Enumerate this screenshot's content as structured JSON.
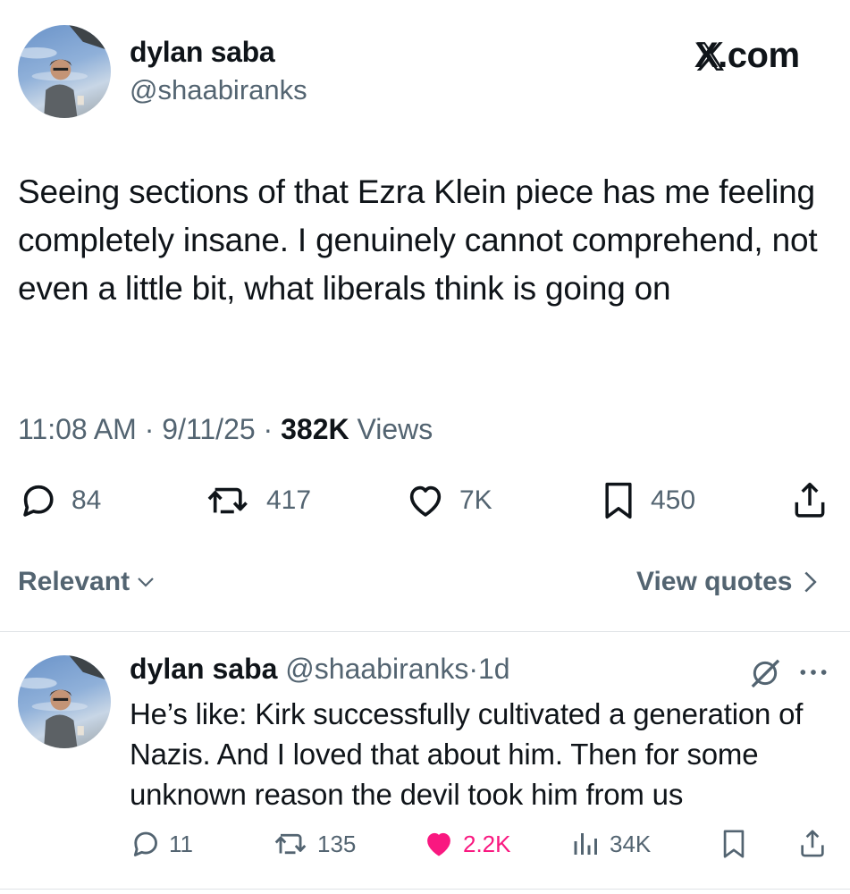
{
  "tweet": {
    "author": {
      "name": "dylan saba",
      "handle": "@shaabiranks"
    },
    "source": "X.com",
    "text": "Seeing sections of that Ezra Klein piece has me feeling completely insane. I genuinely cannot comprehend, not even a little bit, what liberals think is going on",
    "time": "11:08 AM",
    "date": "9/11/25",
    "views_count": "382K",
    "views_label": "Views",
    "separator": "·",
    "stats": {
      "replies": "84",
      "reposts": "417",
      "likes": "7K",
      "bookmarks": "450"
    }
  },
  "filters": {
    "sort_label": "Relevant",
    "view_quotes_label": "View quotes"
  },
  "reply": {
    "name": "dylan saba",
    "handle": "@shaabiranks",
    "separator": "·",
    "time": "1d",
    "text": "He’s like: Kirk successfully cultivated a generation of Nazis. And I loved that about him. Then for some unknown reason the devil took him from us",
    "stats": {
      "replies": "11",
      "reposts": "135",
      "likes": "2.2K",
      "views": "34K"
    },
    "like_color": "#f91880"
  },
  "icons": {
    "reply": "speech-bubble-icon",
    "repost": "repost-arrows-icon",
    "like": "heart-icon",
    "bookmark": "bookmark-icon",
    "share": "share-upload-icon",
    "views": "bar-chart-icon",
    "grok": "grok-slash-circle-icon",
    "more": "more-dots-icon"
  },
  "colors": {
    "text": "#0f1419",
    "secondary": "#536471",
    "like_active": "#f91880",
    "divider": "#dfe3e6"
  }
}
